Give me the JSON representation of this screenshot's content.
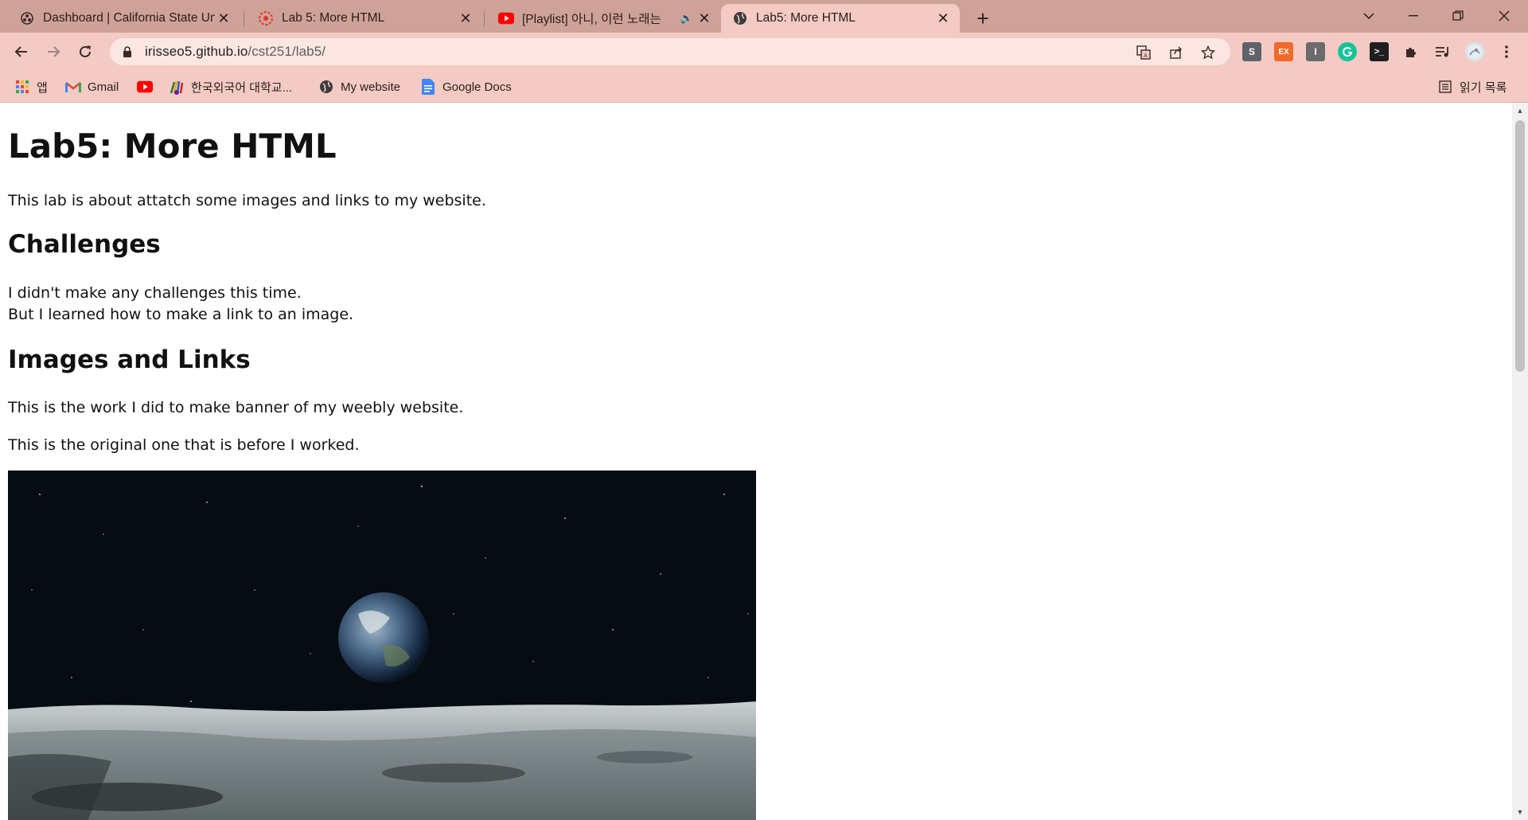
{
  "browser": {
    "tabs": [
      {
        "title": "Dashboard | California State Uni",
        "icon": "dashboard-favicon",
        "active": false
      },
      {
        "title": "Lab 5: More HTML",
        "icon": "canvas-favicon",
        "active": false
      },
      {
        "title": "[Playlist] 아니, 이런 노래는 ",
        "icon": "youtube-favicon",
        "active": false,
        "audio": true
      },
      {
        "title": "Lab5: More HTML",
        "icon": "globe-favicon",
        "active": true
      }
    ],
    "new_tab": "+",
    "address": {
      "host": "irisseo5.github.io",
      "path": "/cst251/lab5/"
    },
    "bookmarks": [
      {
        "label": "앱",
        "icon": "apps-grid-icon"
      },
      {
        "label": "Gmail",
        "icon": "gmail-icon"
      },
      {
        "label": "",
        "icon": "youtube-icon"
      },
      {
        "label": "한국외국어 대학교...",
        "icon": "hufs-icon"
      },
      {
        "label": "My website",
        "icon": "globe-icon"
      },
      {
        "label": "Google Docs",
        "icon": "docs-icon"
      }
    ],
    "reading_list": "읽기 목록",
    "extensions": [
      {
        "label": "S",
        "color": "#5f6368"
      },
      {
        "label": "EX",
        "color": "#f06a2c"
      },
      {
        "label": "I",
        "color": "#6b6b6b"
      },
      {
        "label": "",
        "color": "#15c39a"
      },
      {
        "label": ">_",
        "color": "#1f1f1f"
      }
    ]
  },
  "page": {
    "title": "Lab5: More HTML",
    "intro": "This lab is about attatch some images and links to my website.",
    "challenges_heading": "Challenges",
    "challenges_line1": "I didn't make any challenges this time.",
    "challenges_line2": "But I learned how to make a link to an image.",
    "images_heading": "Images and Links",
    "images_text1": "This is the work I did to make banner of my weebly website.",
    "images_text2": "This is the original one that is before I worked."
  }
}
